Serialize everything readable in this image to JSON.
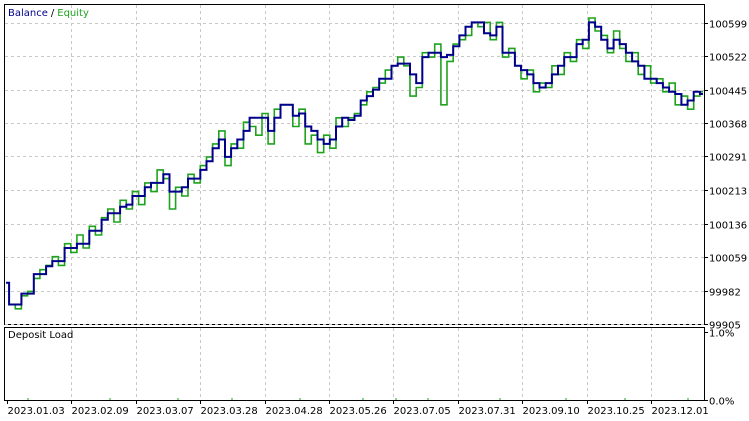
{
  "legend": {
    "balance_label": "Balance",
    "separator": "/",
    "equity_label": "Equity"
  },
  "colors": {
    "balance": "#00008b",
    "equity": "#1fa31f",
    "grid": "#c8c8c8",
    "axis": "#000000"
  },
  "sub_panel": {
    "title": "Deposit Load",
    "y_ticks": [
      "1.0%",
      "0.0%"
    ]
  },
  "chart_data": {
    "type": "line",
    "title": "",
    "y_ticks": [
      100599,
      100522,
      100445,
      100368,
      100291,
      100213,
      100136,
      100059,
      99982,
      99905
    ],
    "ylim": [
      99905,
      100640
    ],
    "x_ticks": [
      "2023.01.03",
      "2023.02.09",
      "2023.03.07",
      "2023.03.28",
      "2023.04.28",
      "2023.05.26",
      "2023.07.05",
      "2023.07.31",
      "2023.09.10",
      "2023.10.25",
      "2023.12.01"
    ],
    "grid": true,
    "legend_position": "top-left",
    "series": [
      {
        "name": "Balance",
        "values": [
          100000,
          99950,
          99950,
          99975,
          99975,
          100020,
          100020,
          100038,
          100050,
          100050,
          100080,
          100080,
          100090,
          100090,
          100120,
          100120,
          100145,
          100160,
          100160,
          100175,
          100180,
          100200,
          100200,
          100220,
          100230,
          100230,
          100250,
          100210,
          100210,
          100220,
          100240,
          100240,
          100260,
          100280,
          100310,
          100330,
          100290,
          100310,
          100330,
          100350,
          100380,
          100380,
          100380,
          100350,
          100380,
          100410,
          100410,
          100385,
          100390,
          100360,
          100350,
          100330,
          100320,
          100330,
          100360,
          100380,
          100375,
          100385,
          100420,
          100430,
          100445,
          100470,
          100470,
          100500,
          100505,
          100505,
          100480,
          100460,
          100520,
          100530,
          100530,
          100520,
          100525,
          100545,
          100570,
          100590,
          100600,
          100600,
          100575,
          100570,
          100590,
          100530,
          100530,
          100500,
          100490,
          100480,
          100460,
          100450,
          100460,
          100480,
          100500,
          100520,
          100520,
          100550,
          100560,
          100600,
          100590,
          100560,
          100540,
          100560,
          100550,
          100530,
          100510,
          100500,
          100470,
          100470,
          100460,
          100450,
          100440,
          100435,
          100410,
          100420,
          100440,
          100435
        ]
      },
      {
        "name": "Equity",
        "values": [
          100000,
          99950,
          99940,
          99970,
          99980,
          100010,
          100030,
          100040,
          100060,
          100040,
          100090,
          100070,
          100110,
          100080,
          100130,
          100110,
          100150,
          100170,
          100140,
          100190,
          100170,
          100210,
          100180,
          100230,
          100210,
          100260,
          100240,
          100170,
          100220,
          100200,
          100250,
          100230,
          100270,
          100290,
          100320,
          100350,
          100270,
          100320,
          100310,
          100370,
          100360,
          100340,
          100390,
          100320,
          100400,
          100410,
          100410,
          100360,
          100400,
          100320,
          100340,
          100300,
          100340,
          100310,
          100380,
          100360,
          100380,
          100390,
          100410,
          100440,
          100450,
          100460,
          100490,
          100500,
          100520,
          100500,
          100430,
          100450,
          100530,
          100520,
          100550,
          100410,
          100510,
          100550,
          100560,
          100570,
          100600,
          100590,
          100600,
          100560,
          100600,
          100520,
          100540,
          100500,
          100470,
          100490,
          100440,
          100460,
          100450,
          100500,
          100480,
          100530,
          100510,
          100560,
          100540,
          100610,
          100580,
          100570,
          100530,
          100580,
          100540,
          100510,
          100530,
          100480,
          100500,
          100460,
          100470,
          100440,
          100460,
          100410,
          100430,
          100400,
          100430,
          100440
        ]
      }
    ]
  }
}
